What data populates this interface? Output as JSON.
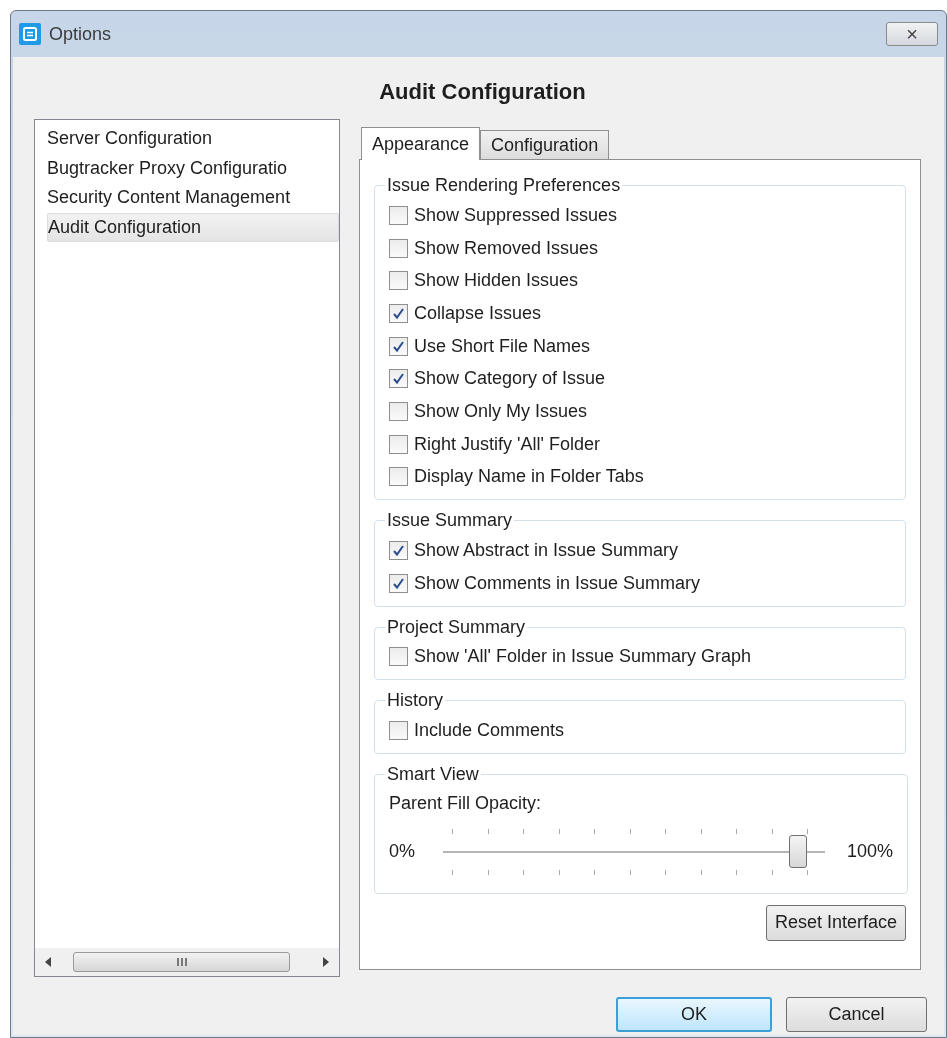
{
  "window": {
    "title": "Options",
    "close": "×"
  },
  "heading": "Audit Configuration",
  "sidebar": {
    "items": [
      {
        "label": "Server Configuration",
        "selected": false
      },
      {
        "label": "Bugtracker Proxy Configuratio",
        "selected": false
      },
      {
        "label": "Security Content Management",
        "selected": false
      },
      {
        "label": "Audit Configuration",
        "selected": true
      }
    ]
  },
  "tabs": [
    {
      "label": "Appearance",
      "selected": true
    },
    {
      "label": "Configuration",
      "selected": false
    }
  ],
  "groups": [
    {
      "title": "Issue Rendering Preferences",
      "items": [
        {
          "kind": "checkbox",
          "label": "Show Suppressed Issues",
          "checked": false
        },
        {
          "kind": "checkbox",
          "label": "Show Removed Issues",
          "checked": false
        },
        {
          "kind": "checkbox",
          "label": "Show Hidden Issues",
          "checked": false
        },
        {
          "kind": "checkbox",
          "label": "Collapse Issues",
          "checked": true
        },
        {
          "kind": "checkbox",
          "label": "Use Short File Names",
          "checked": true
        },
        {
          "kind": "checkbox",
          "label": "Show Category of Issue",
          "checked": true
        },
        {
          "kind": "checkbox",
          "label": "Show Only My Issues",
          "checked": false
        },
        {
          "kind": "checkbox",
          "label": "Right Justify 'All' Folder",
          "checked": false
        },
        {
          "kind": "checkbox",
          "label": "Display Name in Folder Tabs",
          "checked": false
        }
      ]
    },
    {
      "title": "Issue Summary",
      "items": [
        {
          "kind": "checkbox",
          "label": "Show Abstract in Issue Summary",
          "checked": true
        },
        {
          "kind": "checkbox",
          "label": "Show Comments in Issue Summary",
          "checked": true
        }
      ]
    },
    {
      "title": "Project Summary",
      "items": [
        {
          "kind": "checkbox",
          "label": "Show 'All' Folder in Issue Summary Graph",
          "checked": false
        }
      ]
    },
    {
      "title": "History",
      "items": [
        {
          "kind": "checkbox",
          "label": "Include Comments",
          "checked": false
        }
      ]
    },
    {
      "title": "Smart View",
      "items": [
        {
          "kind": "slider",
          "label": "Parent Fill Opacity:",
          "min_label": "0%",
          "max_label": "100%",
          "level": 0.93
        }
      ]
    }
  ],
  "reset_button": "Reset Interface",
  "buttons": [
    {
      "label": "OK",
      "kind": "default"
    },
    {
      "label": "Cancel",
      "kind": "normal"
    }
  ]
}
